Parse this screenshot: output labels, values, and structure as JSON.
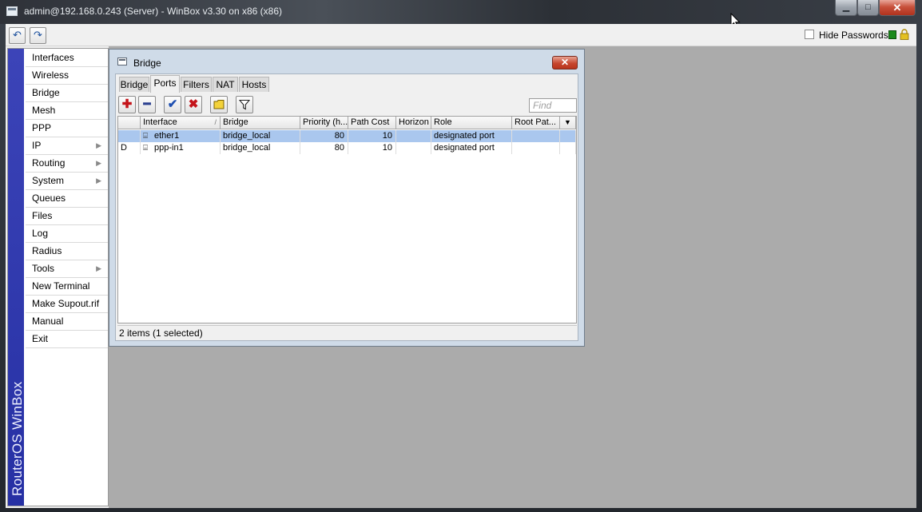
{
  "window": {
    "title": "admin@192.168.0.243 (Server) - WinBox v3.30 on x86 (x86)",
    "min_glyph": "▁",
    "max_glyph": "□",
    "close_glyph": "✕"
  },
  "toolbar": {
    "undo_glyph": "↶",
    "redo_glyph": "↷",
    "hide_passwords_label": "Hide Passwords",
    "hide_passwords_checked": false,
    "status_color": "#1c8a1c"
  },
  "sidebar": {
    "brand": "RouterOS WinBox",
    "brand_color": "#2a33a8",
    "items": [
      {
        "label": "Interfaces",
        "submenu": false
      },
      {
        "label": "Wireless",
        "submenu": false
      },
      {
        "label": "Bridge",
        "submenu": false
      },
      {
        "label": "Mesh",
        "submenu": false
      },
      {
        "label": "PPP",
        "submenu": false
      },
      {
        "label": "IP",
        "submenu": true
      },
      {
        "label": "Routing",
        "submenu": true
      },
      {
        "label": "System",
        "submenu": true
      },
      {
        "label": "Queues",
        "submenu": false
      },
      {
        "label": "Files",
        "submenu": false
      },
      {
        "label": "Log",
        "submenu": false
      },
      {
        "label": "Radius",
        "submenu": false
      },
      {
        "label": "Tools",
        "submenu": true
      },
      {
        "label": "New Terminal",
        "submenu": false
      },
      {
        "label": "Make Supout.rif",
        "submenu": false
      },
      {
        "label": "Manual",
        "submenu": false
      },
      {
        "label": "Exit",
        "submenu": false
      }
    ],
    "submenu_arrow": "▶"
  },
  "bridge_window": {
    "title": "Bridge",
    "close_glyph": "✕",
    "tabs": [
      {
        "label": "Bridge",
        "active": false
      },
      {
        "label": "Ports",
        "active": true
      },
      {
        "label": "Filters",
        "active": false
      },
      {
        "label": "NAT",
        "active": false
      },
      {
        "label": "Hosts",
        "active": false
      }
    ],
    "actions": {
      "add_glyph": "✚",
      "remove_glyph": "━",
      "enable_glyph": "✔",
      "disable_glyph": "✖",
      "comment_icon": "comment-icon",
      "filter_icon": "filter-icon"
    },
    "find_placeholder": "Find",
    "columns": [
      "",
      "Interface",
      "Bridge",
      "Priority (h...",
      "Path Cost",
      "Horizon",
      "Role",
      "Root Pat...",
      "▼"
    ],
    "sort_indicator": "/",
    "rows": [
      {
        "flag": "",
        "interface": "ether1",
        "bridge": "bridge_local",
        "priority": "80",
        "path_cost": "10",
        "horizon": "",
        "role": "designated port",
        "root_path": "",
        "selected": true
      },
      {
        "flag": "D",
        "interface": "ppp-in1",
        "bridge": "bridge_local",
        "priority": "80",
        "path_cost": "10",
        "horizon": "",
        "role": "designated port",
        "root_path": "",
        "selected": false
      }
    ],
    "iface_glyph": "⌸",
    "status": "2 items (1 selected)",
    "selection_color": "#aac7ee"
  }
}
